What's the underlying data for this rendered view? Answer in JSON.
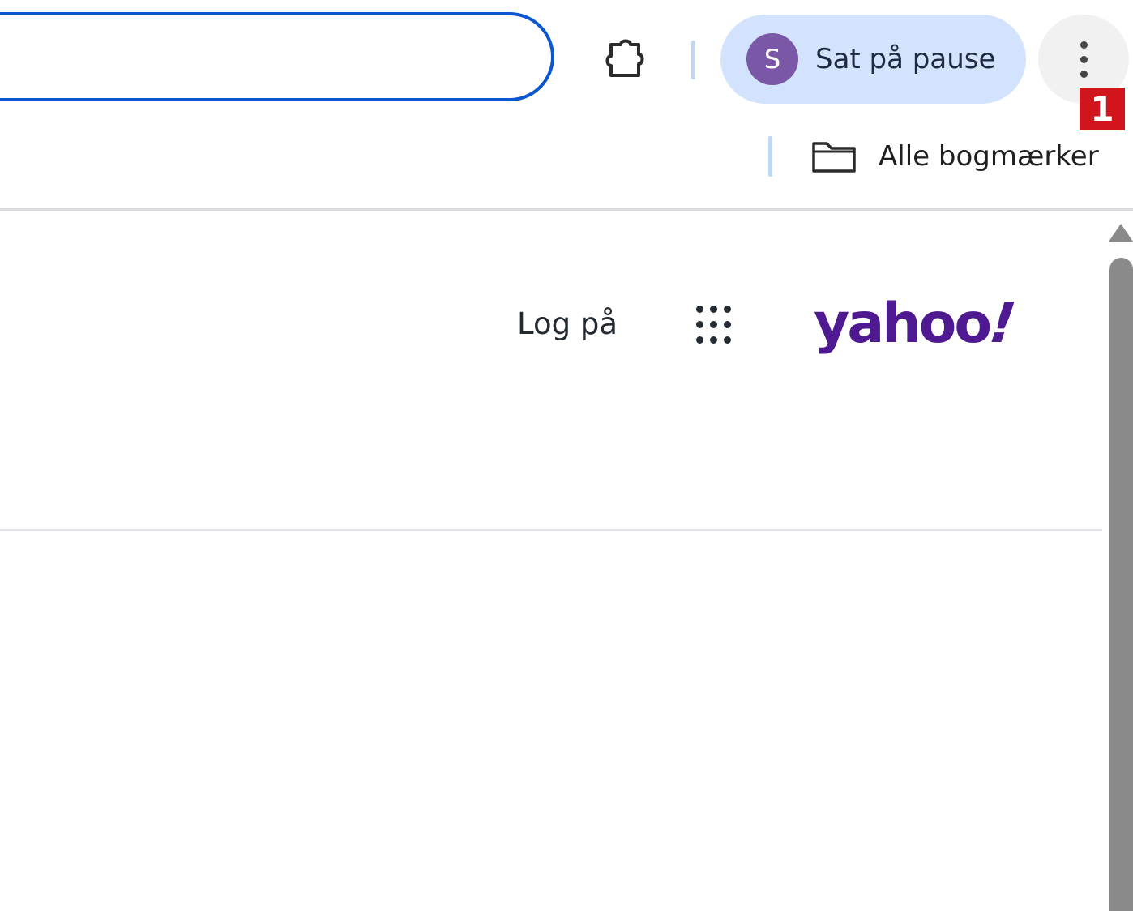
{
  "toolbar": {
    "address_bar_value": "",
    "extensions_icon": "puzzle-piece-icon",
    "profile": {
      "avatar_initial": "S",
      "status_label": "Sat på pause",
      "avatar_color": "#7b57a8",
      "chip_color": "#d3e3fd"
    },
    "menu_icon": "vertical-dots-icon",
    "marker_label": "1",
    "marker_color": "#d0151c"
  },
  "bookmarks_bar": {
    "all_bookmarks_icon": "folder-icon",
    "all_bookmarks_label": "Alle bogmærker"
  },
  "page": {
    "sign_in_label": "Log på",
    "apps_icon": "apps-grid-icon",
    "logo_text": "yahoo",
    "logo_mark": "!",
    "logo_color": "#4f1a91"
  },
  "colors": {
    "omnibox_focus": "#0b57d0",
    "scrollbar": "#8a8a8a"
  }
}
